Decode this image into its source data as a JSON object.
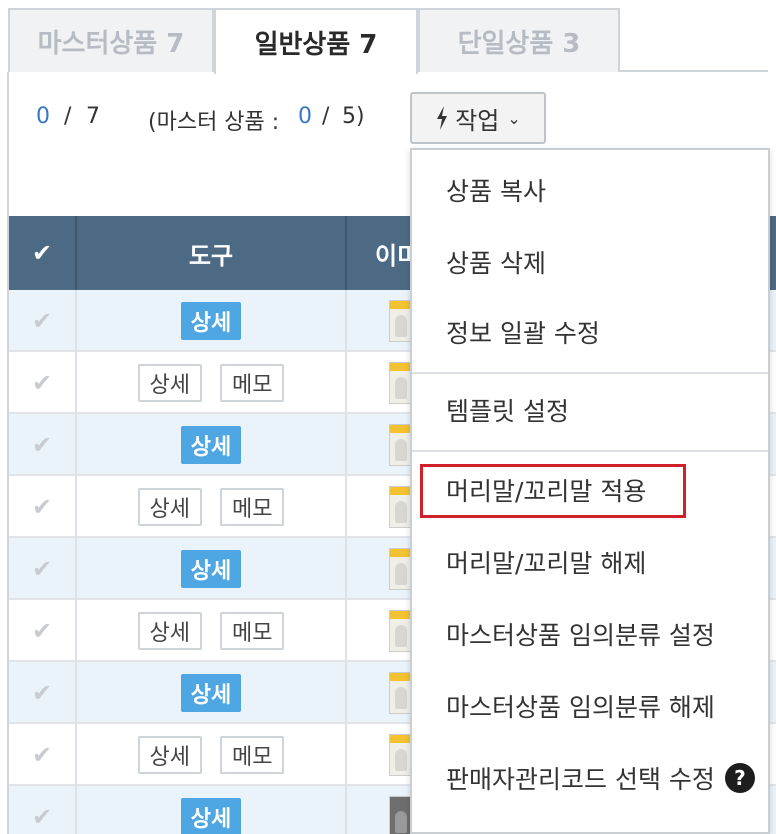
{
  "tabs": [
    {
      "label": "마스터상품 7",
      "active": false
    },
    {
      "label": "일반상품 7",
      "active": true
    },
    {
      "label": "단일상품 3",
      "active": false
    }
  ],
  "counts": {
    "selected": "0",
    "sep": "/",
    "total": "7",
    "master_open": "(마스터 상품 :",
    "master_selected": "0",
    "master_sep": "/",
    "master_total": "5",
    "master_close": ")"
  },
  "work_button": {
    "label": "작업",
    "icon": "lightning-icon",
    "chevron": "⌄"
  },
  "table": {
    "headers": {
      "check": "✔",
      "tool": "도구",
      "image": "이미"
    },
    "rows": [
      {
        "type": "blue",
        "buttons": [
          "상세"
        ]
      },
      {
        "type": "white",
        "buttons": [
          "상세",
          "메모"
        ]
      },
      {
        "type": "blue",
        "buttons": [
          "상세"
        ]
      },
      {
        "type": "white",
        "buttons": [
          "상세",
          "메모"
        ]
      },
      {
        "type": "blue",
        "buttons": [
          "상세"
        ]
      },
      {
        "type": "white",
        "buttons": [
          "상세",
          "메모"
        ]
      },
      {
        "type": "blue",
        "buttons": [
          "상세"
        ]
      },
      {
        "type": "white",
        "buttons": [
          "상세",
          "메모"
        ]
      },
      {
        "type": "blue",
        "buttons": [
          "상세"
        ]
      }
    ]
  },
  "menu": {
    "items": [
      {
        "label": "상품 복사"
      },
      {
        "label": "상품 삭제"
      },
      {
        "label": "정보 일괄 수정"
      },
      {
        "label": "템플릿 설정"
      },
      {
        "label": "머리말/꼬리말 적용",
        "highlighted": true
      },
      {
        "label": "머리말/꼬리말 해제"
      },
      {
        "label": "마스터상품 임의분류 설정"
      },
      {
        "label": "마스터상품 임의분류 해제"
      },
      {
        "label": "판매자관리코드 선택 수정",
        "help": "?"
      }
    ]
  },
  "colors": {
    "header": "#4d6a85",
    "accent": "#4ea6e2",
    "highlight": "#d0202a",
    "row_alt": "#eaf2fa"
  }
}
